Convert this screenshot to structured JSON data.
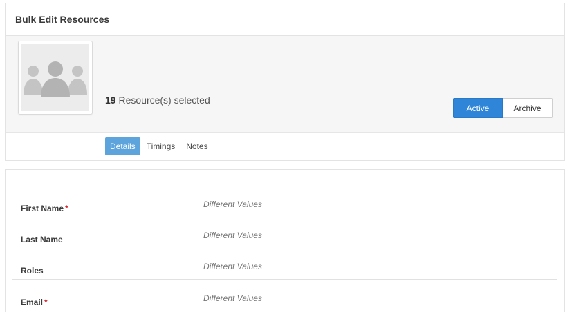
{
  "header": {
    "title": "Bulk Edit Resources"
  },
  "summary": {
    "selected_count": "19",
    "selected_suffix": "Resource(s) selected",
    "avatar_icon": "users-group-icon"
  },
  "status": {
    "active_label": "Active",
    "archive_label": "Archive",
    "selected": "Active",
    "accent_color": "#2f86d9"
  },
  "tabs": [
    {
      "label": "Details",
      "selected": true
    },
    {
      "label": "Timings",
      "selected": false
    },
    {
      "label": "Notes",
      "selected": false
    }
  ],
  "form": {
    "fields": [
      {
        "label": "First Name",
        "required": "*",
        "value": "Different Values"
      },
      {
        "label": "Last Name",
        "required": "",
        "value": "Different Values"
      },
      {
        "label": "Roles",
        "required": "",
        "value": "Different Values"
      },
      {
        "label": "Email",
        "required": "*",
        "value": "Different Values"
      }
    ]
  }
}
